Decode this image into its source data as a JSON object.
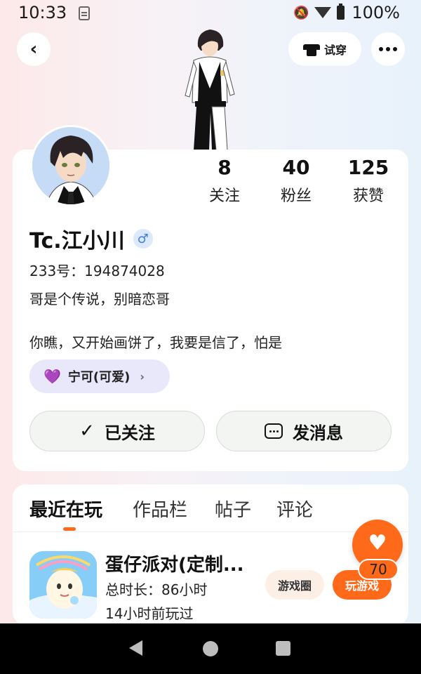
{
  "status_bar": {
    "time": "10:33",
    "battery": "100%"
  },
  "nav": {
    "tryon_label": "试穿"
  },
  "profile": {
    "stats": [
      {
        "num": "8",
        "label": "关注"
      },
      {
        "num": "40",
        "label": "粉丝"
      },
      {
        "num": "125",
        "label": "获赞"
      }
    ],
    "nickname": "Tc.江小川",
    "gender_symbol": "♂",
    "uid": "233号：194874028",
    "bio": "哥是个传说，别暗恋哥",
    "quote": "你瞧，又开始画饼了，我要是信了，怕是",
    "cp_label": "宁可(可爱)",
    "follow_label": "已关注",
    "message_label": "发消息"
  },
  "tabs": [
    "最近在玩",
    "作品栏",
    "帖子",
    "评论"
  ],
  "game": {
    "title": "蛋仔派对(定制...",
    "duration": "总时长：86小时",
    "last_played": "14小时前玩过",
    "circle_label": "游戏圈",
    "play_label": "玩游戏"
  },
  "like_count": "70",
  "colors": {
    "accent": "#ff6a1a",
    "cp_chip": "#e9e8fb",
    "gender": "#3e7fe0"
  }
}
